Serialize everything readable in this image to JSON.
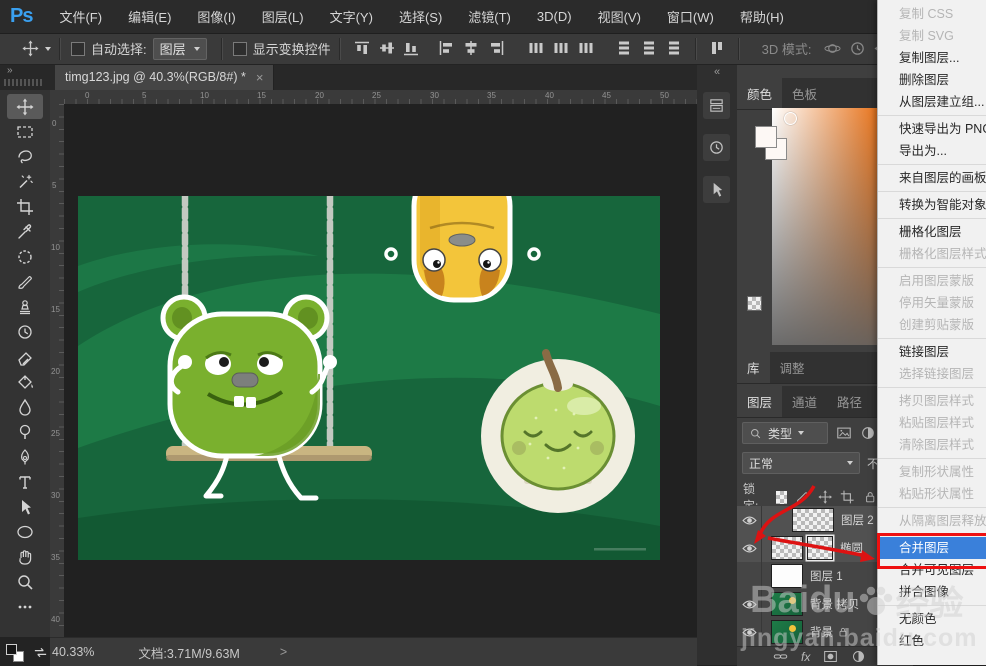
{
  "menu_bar": {
    "logo": "Ps",
    "items": [
      "文件(F)",
      "编辑(E)",
      "图像(I)",
      "图层(L)",
      "文字(Y)",
      "选择(S)",
      "滤镜(T)",
      "3D(D)",
      "视图(V)",
      "窗口(W)",
      "帮助(H)"
    ]
  },
  "options_bar": {
    "auto_select_label": "自动选择:",
    "auto_select_value": "图层",
    "show_transform_label": "显示变换控件",
    "mode_3d_label": "3D 模式:",
    "icons": [
      "move-tool",
      "align-top",
      "align-middle",
      "align-bottom",
      "align-left",
      "align-center",
      "align-right",
      "distribute-top",
      "distribute-middle",
      "distribute-bottom",
      "distribute-left",
      "distribute-center",
      "distribute-right",
      "distribute-spacing",
      "3d-orbit",
      "3d-roll",
      "3d-pan"
    ]
  },
  "document_tab": {
    "title": "timg123.jpg @ 40.3%(RGB/8#) *",
    "close_glyph": "×"
  },
  "rulers": {
    "horizontal": [
      "0",
      "5",
      "10",
      "15",
      "20",
      "25",
      "30",
      "35",
      "40",
      "45",
      "50"
    ],
    "vertical": [
      "0",
      "5",
      "10",
      "15",
      "20",
      "25",
      "30",
      "35",
      "40"
    ]
  },
  "toolbar": {
    "tools": [
      "move",
      "rect-marquee",
      "lasso",
      "magic-wand",
      "crop",
      "eyedropper",
      "spot-healing",
      "brush",
      "clone-stamp",
      "history-brush",
      "eraser",
      "paint-bucket",
      "blur",
      "dodge",
      "pen",
      "type",
      "path-select",
      "ellipse-shape",
      "hand",
      "zoom",
      "more-tools"
    ],
    "expand_glyph": "»",
    "collapse_glyph": "«"
  },
  "panels": {
    "color": {
      "tabs": [
        "颜色",
        "色板"
      ]
    },
    "library": {
      "tabs": [
        "库",
        "调整"
      ]
    },
    "layers": {
      "tabs": [
        "图层",
        "通道",
        "路径"
      ],
      "filter_label": "类型",
      "blend_mode": "正常",
      "opacity_label_fragment": "不",
      "lock_label": "锁定:",
      "fx_glyph": "fx",
      "rows": [
        {
          "name": "图层 2"
        },
        {
          "name": "椭圆"
        },
        {
          "name": "图层 1"
        },
        {
          "name": "背景 拷贝"
        },
        {
          "name": "背景"
        }
      ]
    }
  },
  "context_menu": {
    "items": [
      {
        "label": "复制 CSS",
        "state": "disabled"
      },
      {
        "label": "复制 SVG",
        "state": "disabled"
      },
      {
        "label": "复制图层...",
        "state": "enabled"
      },
      {
        "label": "删除图层",
        "state": "enabled"
      },
      {
        "label": "从图层建立组...",
        "state": "enabled"
      },
      {
        "label": "快速导出为 PNG",
        "state": "enabled"
      },
      {
        "label": "导出为...",
        "state": "enabled"
      },
      {
        "label": "来自图层的画板...",
        "state": "enabled"
      },
      {
        "label": "转换为智能对象",
        "state": "enabled"
      },
      {
        "label": "栅格化图层",
        "state": "enabled"
      },
      {
        "label": "栅格化图层样式",
        "state": "disabled"
      },
      {
        "label": "启用图层蒙版",
        "state": "disabled"
      },
      {
        "label": "停用矢量蒙版",
        "state": "disabled"
      },
      {
        "label": "创建剪贴蒙版",
        "state": "disabled"
      },
      {
        "label": "链接图层",
        "state": "enabled"
      },
      {
        "label": "选择链接图层",
        "state": "disabled"
      },
      {
        "label": "拷贝图层样式",
        "state": "disabled"
      },
      {
        "label": "粘贴图层样式",
        "state": "disabled"
      },
      {
        "label": "清除图层样式",
        "state": "disabled"
      },
      {
        "label": "复制形状属性",
        "state": "disabled"
      },
      {
        "label": "粘贴形状属性",
        "state": "disabled"
      },
      {
        "label": "从隔离图层释放",
        "state": "disabled"
      },
      {
        "label": "合并图层",
        "state": "highlighted"
      },
      {
        "label": "合并可见图层",
        "state": "enabled"
      },
      {
        "label": "拼合图像",
        "state": "enabled"
      },
      {
        "label": "无颜色",
        "state": "enabled"
      },
      {
        "label": "红色",
        "state": "enabled"
      }
    ]
  },
  "status_bar": {
    "zoom_level": "40.33%",
    "document_info": "文档:3.71M/9.63M",
    "expand_glyph": ">"
  },
  "watermark": {
    "brand": "Baidu",
    "brand_cn": "经验",
    "url": "jingyan.baidu.com"
  },
  "colors": {
    "menu_highlight": "#3a80da",
    "annotation_red": "#ee1010",
    "artwork_green": "#17663c",
    "monster_green": "#7ab02e",
    "character_yellow": "#f3c53a",
    "apple_green": "#bddb6e"
  }
}
